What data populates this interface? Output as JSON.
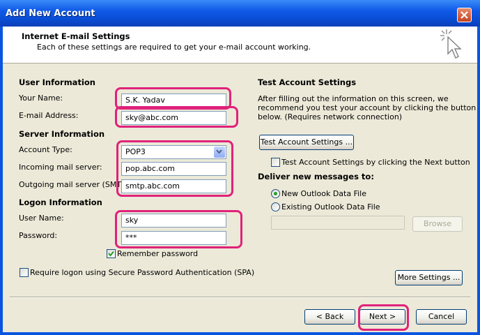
{
  "window": {
    "title": "Add New Account"
  },
  "header": {
    "title": "Internet E-mail Settings",
    "subtitle": "Each of these settings are required to get your e-mail account working."
  },
  "user_info": {
    "heading": "User Information",
    "name_label": "Your Name:",
    "name_value": "S.K. Yadav",
    "email_label": "E-mail Address:",
    "email_value": "sky@abc.com"
  },
  "server_info": {
    "heading": "Server Information",
    "account_type_label": "Account Type:",
    "account_type_value": "POP3",
    "incoming_label": "Incoming mail server:",
    "incoming_value": "pop.abc.com",
    "outgoing_label": "Outgoing mail server (SMTP):",
    "outgoing_value": "smtp.abc.com"
  },
  "logon_info": {
    "heading": "Logon Information",
    "username_label": "User Name:",
    "username_value": "sky",
    "password_label": "Password:",
    "password_value": "***",
    "remember_label": "Remember password",
    "remember_checked": true,
    "spa_label": "Require logon using Secure Password Authentication (SPA)",
    "spa_checked": false
  },
  "test_settings": {
    "heading": "Test Account Settings",
    "description_1": "After filling out the information on this screen, we",
    "description_2": "recommend you test your account by clicking the button",
    "description_3": "below. (Requires network connection)",
    "test_button": "Test Account Settings ...",
    "test_next_label": "Test Account Settings by clicking the Next button",
    "test_next_checked": false
  },
  "delivery": {
    "heading": "Deliver new messages to:",
    "new_file_label": "New Outlook Data File",
    "existing_file_label": "Existing Outlook Data File",
    "selected": "New Outlook Data File",
    "path_value": "",
    "browse_button": "Browse"
  },
  "more_settings_button": "More Settings ...",
  "footer": {
    "back_button": "< Back",
    "next_button": "Next >",
    "cancel_button": "Cancel"
  },
  "colors": {
    "titlebar": "#0a4ed6",
    "dialog_bg": "#ece9d8",
    "highlight": "#e0227a",
    "close_button": "#c4431f"
  },
  "icons": [
    "close-icon",
    "wizard-cursor-icon",
    "dropdown-chevron-icon",
    "checkmark-icon"
  ]
}
